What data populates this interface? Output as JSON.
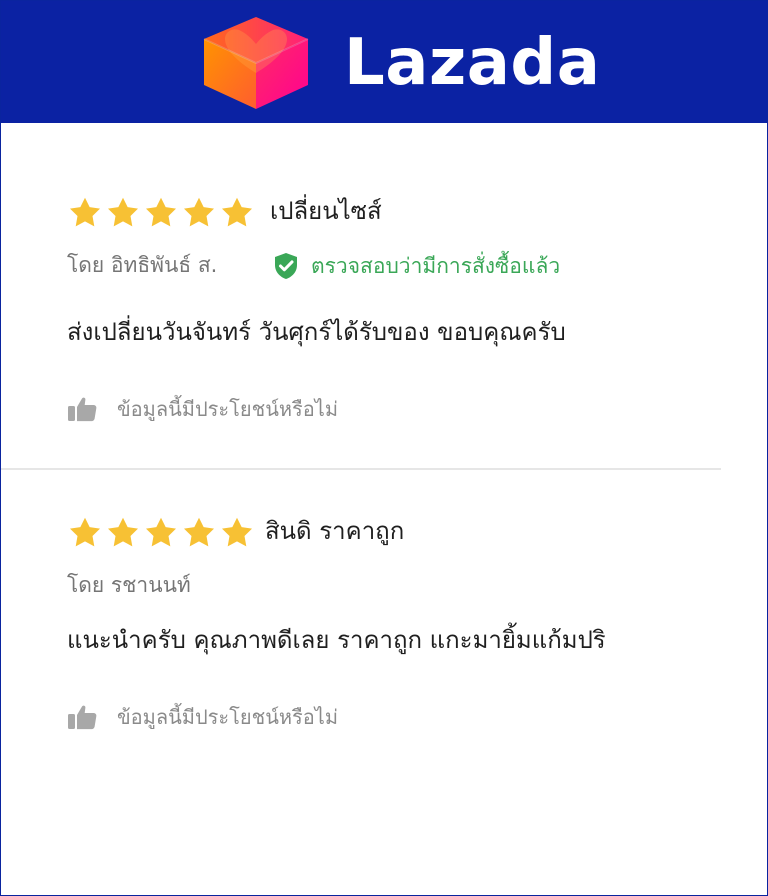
{
  "brand": {
    "name": "Lazada",
    "header_color": "#0b22a3"
  },
  "reviews": [
    {
      "rating": 5,
      "max_rating": 5,
      "title": "เปลี่ยนไซส์",
      "author": "โดย อิทธิพันธ์ ส.",
      "verified_text": "ตรวจสอบว่ามีการสั่งซื้อแล้ว",
      "body": "ส่งเปลี่ยนวันจันทร์ วันศุกร์ได้รับของ ขอบคุณครับ",
      "helpful_text": "ข้อมูลนี้มีประโยชน์หรือไม่"
    },
    {
      "rating": 5,
      "max_rating": 5,
      "title": "สินดิ ราคาถูก",
      "author": "โดย รชานนท์",
      "body": "แนะนำครับ คุณภาพดีเลย ราคาถูก แกะมายิ้มแก้มปริ",
      "helpful_text": "ข้อมูลนี้มีประโยชน์หรือไม่"
    }
  ],
  "colors": {
    "star": "#f7c134",
    "verified": "#3aa757",
    "muted": "#757575",
    "text": "#1f1f1f"
  },
  "icons": {
    "star": "star-icon",
    "verified": "shield-check-icon",
    "thumb": "thumbs-up-icon",
    "logo": "lazada-heart-box-icon"
  }
}
